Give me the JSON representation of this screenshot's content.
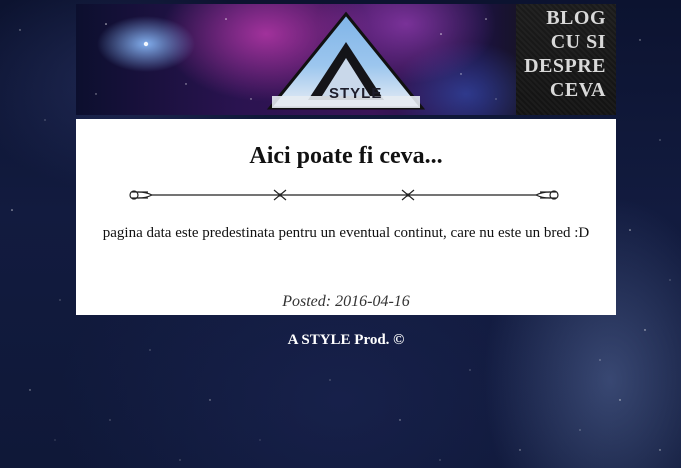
{
  "header": {
    "logo_text": "STYLE",
    "blog_title_lines": [
      "BLOG",
      "CU SI",
      "DESPRE",
      "CEVA"
    ]
  },
  "post": {
    "title": "Aici poate fi ceva...",
    "body": "pagina data este predestinata pentru un eventual continut, care nu este un bred :D",
    "date": "Posted: 2016-04-16"
  },
  "footer": {
    "text": "A STYLE Prod. ©"
  },
  "colors": {
    "page_background": "#121b3f",
    "content_background": "#ffffff",
    "footer_text": "#ffffff"
  }
}
